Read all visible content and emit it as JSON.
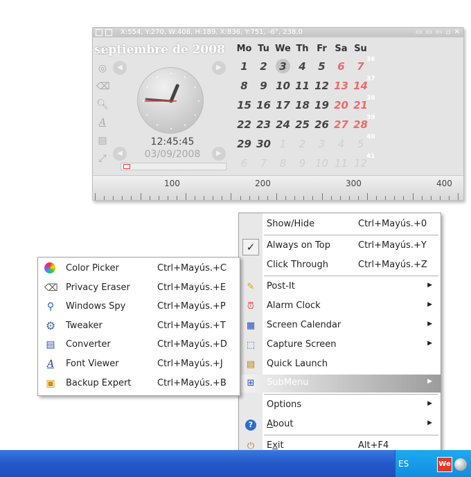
{
  "widget": {
    "coords": "X:554, Y:270, W:408, H:189, X:836, Y:751, -6°, 238,0",
    "month_title": "septiembre de 2008",
    "time": "12:45:45",
    "date": "03/09/2008",
    "progress_fraction": 0.06,
    "progress_color": "#ff3333",
    "clock": {
      "hour": 12,
      "minute": 45,
      "second": 45
    },
    "side_icons": [
      "capture-icon",
      "color-picker-icon",
      "eraser-icon",
      "spy-icon",
      "font-viewer-icon",
      "converter-icon",
      "ruler-icon"
    ],
    "calendar": {
      "headers": [
        "Mo",
        "Tu",
        "We",
        "Th",
        "Fr",
        "Sa",
        "Su"
      ],
      "weeks": [
        [
          "1",
          "2",
          "3",
          "4",
          "5",
          "6",
          "7"
        ],
        [
          "8",
          "9",
          "10",
          "11",
          "12",
          "13",
          "14"
        ],
        [
          "15",
          "16",
          "17",
          "18",
          "19",
          "20",
          "21"
        ],
        [
          "22",
          "23",
          "24",
          "25",
          "26",
          "27",
          "28"
        ],
        [
          "29",
          "30",
          "1",
          "2",
          "3",
          "4",
          "5"
        ],
        [
          "6",
          "7",
          "8",
          "9",
          "10",
          "11",
          "12"
        ]
      ],
      "week_numbers": [
        "36",
        "37",
        "38",
        "39",
        "40",
        "41"
      ],
      "today": "3"
    },
    "ruler": {
      "labels": [
        "100",
        "200",
        "300",
        "400"
      ]
    }
  },
  "main_menu": {
    "items": [
      {
        "label": "Show/Hide",
        "shortcut": "Ctrl+Mayús.+0"
      },
      {
        "label": "Always on Top",
        "shortcut": "Ctrl+Mayús.+Y",
        "checked": true
      },
      {
        "label": "Click Through",
        "shortcut": "Ctrl+Mayús.+Z"
      },
      {
        "label": "Post-It",
        "shortcut": "",
        "submenu": true,
        "icon": "post-it-icon"
      },
      {
        "label": "Alarm Clock",
        "shortcut": "",
        "submenu": true,
        "icon": "alarm-clock-icon"
      },
      {
        "label": "Screen Calendar",
        "shortcut": "",
        "submenu": true,
        "icon": "calendar-icon"
      },
      {
        "label": "Capture Screen",
        "shortcut": "",
        "submenu": true,
        "icon": "capture-icon"
      },
      {
        "label": "Quick Launch",
        "shortcut": "",
        "icon": "quick-launch-icon"
      },
      {
        "label": "SubMenu",
        "shortcut": "",
        "submenu": true,
        "icon": "submenu-icon",
        "highlighted": true
      },
      {
        "label": "Options",
        "shortcut": "",
        "submenu": true
      },
      {
        "label": "About",
        "shortcut": "",
        "submenu": true,
        "icon": "help-icon"
      },
      {
        "label": "Exit",
        "shortcut": "Alt+F4",
        "icon": "exit-icon"
      }
    ]
  },
  "sub_menu": {
    "items": [
      {
        "label": "Color Picker",
        "shortcut": "Ctrl+Mayús.+C",
        "icon": "color-picker-icon"
      },
      {
        "label": "Privacy Eraser",
        "shortcut": "Ctrl+Mayús.+E",
        "icon": "eraser-icon"
      },
      {
        "label": "Windows Spy",
        "shortcut": "Ctrl+Mayús.+P",
        "icon": "spy-icon"
      },
      {
        "label": "Tweaker",
        "shortcut": "Ctrl+Mayús.+T",
        "icon": "gear-icon"
      },
      {
        "label": "Converter",
        "shortcut": "Ctrl+Mayús.+D",
        "icon": "converter-icon"
      },
      {
        "label": "Font Viewer",
        "shortcut": "Ctrl+Mayús.+J",
        "icon": "font-viewer-icon"
      },
      {
        "label": "Backup Expert",
        "shortcut": "Ctrl+Mayús.+B",
        "icon": "backup-icon"
      }
    ]
  },
  "taskbar": {
    "language": "ES",
    "tray_app_label": "We"
  },
  "colors": {
    "weekend": "#ec6a6a",
    "taskbar": "#2457c8",
    "highlight": "#9c9c9c"
  }
}
